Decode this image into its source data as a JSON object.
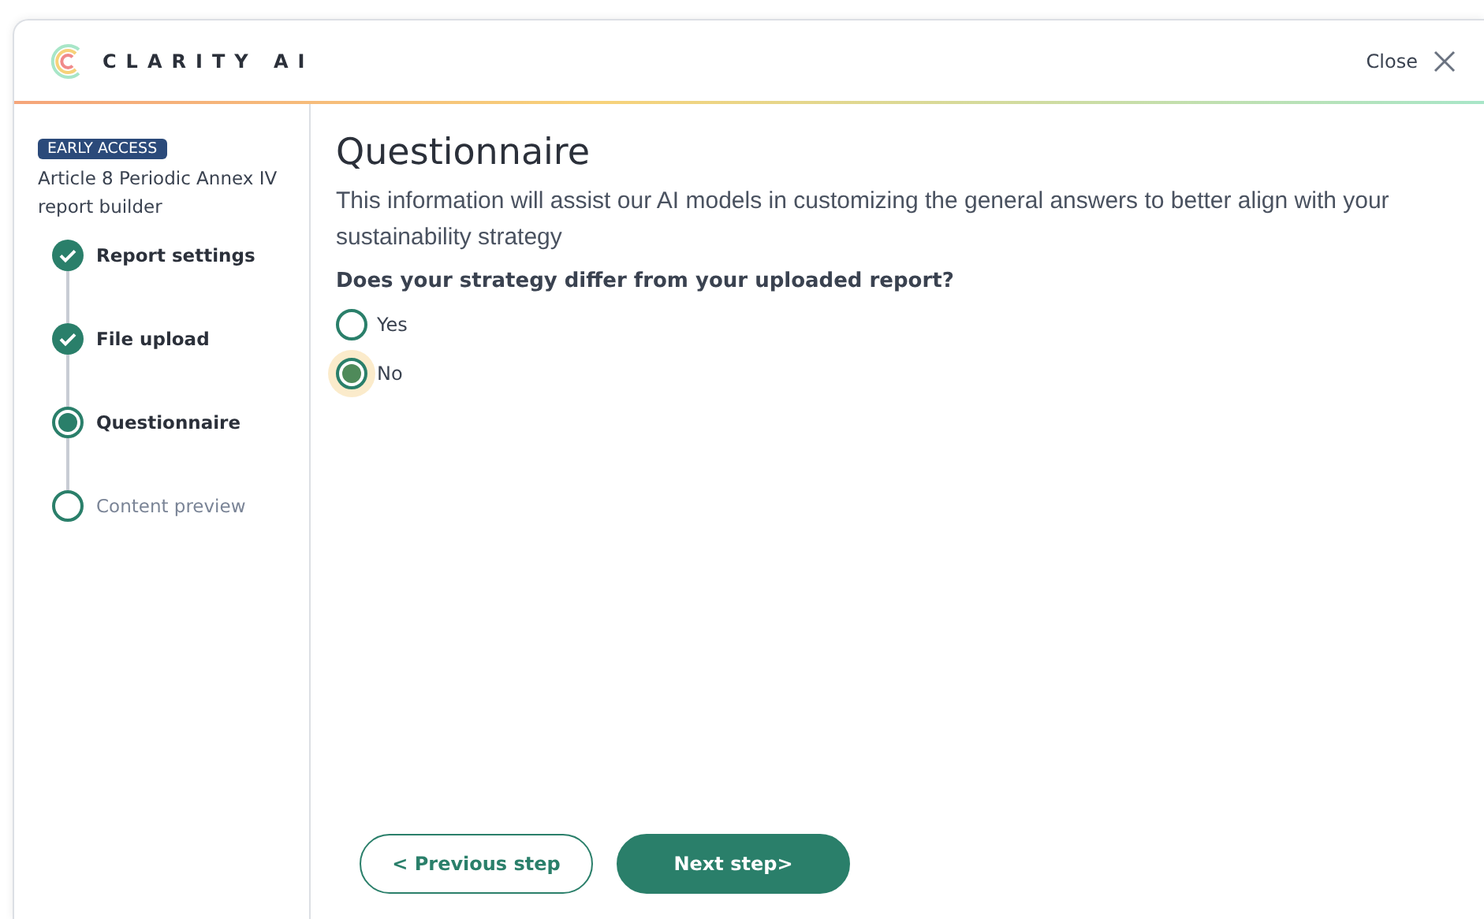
{
  "header": {
    "brand": "CLARITY AI",
    "close_label": "Close"
  },
  "sidebar": {
    "badge": "EARLY ACCESS",
    "title": "Article 8 Periodic Annex IV report builder",
    "steps": [
      {
        "label": "Report settings",
        "kind": "done"
      },
      {
        "label": "File upload",
        "kind": "done"
      },
      {
        "label": "Questionnaire",
        "kind": "current"
      },
      {
        "label": "Content preview",
        "kind": "pending"
      }
    ]
  },
  "main": {
    "title": "Questionnaire",
    "description": "This information will assist our AI models in customizing the general answers to better align with your sustainability strategy",
    "question": "Does your strategy differ from your uploaded report?",
    "options": [
      {
        "label": "Yes",
        "selected": false
      },
      {
        "label": "No",
        "selected": true
      }
    ]
  },
  "buttons": {
    "previous": "< Previous step",
    "next": "Next step>"
  }
}
